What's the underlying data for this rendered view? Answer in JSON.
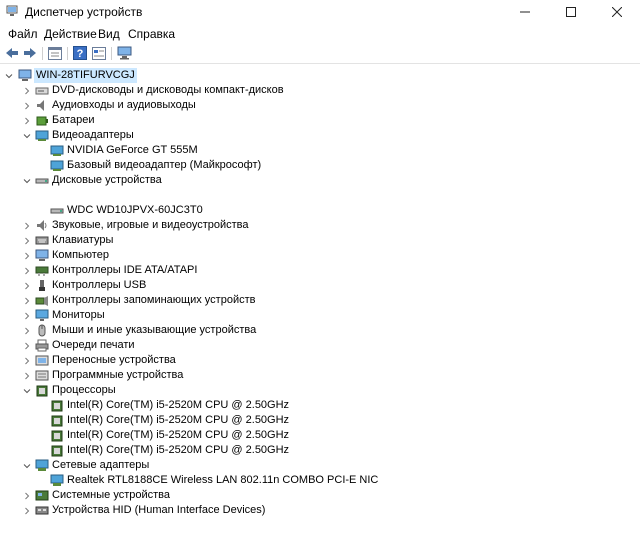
{
  "window": {
    "title": "Диспетчер устройств"
  },
  "menu": [
    "Файл",
    "Действие",
    "Вид",
    "Справка"
  ],
  "tree": {
    "root": "WIN-28TIFURVCGJ",
    "rows": [
      {
        "label": "DVD-дисководы и дисководы компакт-дисков",
        "icon": "dvd-drive-icon"
      },
      {
        "label": "Аудиовходы и аудиовыходы",
        "icon": "audio-icon"
      },
      {
        "label": "Батареи",
        "icon": "battery-icon"
      },
      {
        "label": "Видеоадаптеры",
        "icon": "display-adapter-icon"
      },
      {
        "label": "NVIDIA GeForce GT 555M",
        "icon": "display-adapter-icon"
      },
      {
        "label": "Базовый видеоадаптер (Майкрософт)",
        "icon": "display-adapter-icon"
      },
      {
        "label": "Дисковые устройства",
        "icon": "disk-drive-icon"
      },
      {
        "label": "WDC WD10JPVX-60JC3T0",
        "icon": "disk-drive-icon"
      },
      {
        "label": "Звуковые, игровые и видеоустройства",
        "icon": "sound-icon"
      },
      {
        "label": "Клавиатуры",
        "icon": "keyboard-icon"
      },
      {
        "label": "Компьютер",
        "icon": "computer-icon"
      },
      {
        "label": "Контроллеры IDE ATA/ATAPI",
        "icon": "ide-controller-icon"
      },
      {
        "label": "Контроллеры USB",
        "icon": "usb-icon"
      },
      {
        "label": "Контроллеры запоминающих устройств",
        "icon": "storage-controller-icon"
      },
      {
        "label": "Мониторы",
        "icon": "monitor-icon"
      },
      {
        "label": "Мыши и иные указывающие устройства",
        "icon": "mouse-icon"
      },
      {
        "label": "Очереди печати",
        "icon": "printer-icon"
      },
      {
        "label": "Переносные устройства",
        "icon": "portable-device-icon"
      },
      {
        "label": "Программные устройства",
        "icon": "software-device-icon"
      },
      {
        "label": "Процессоры",
        "icon": "processor-icon"
      },
      {
        "label": "Intel(R) Core(TM) i5-2520M CPU @ 2.50GHz",
        "icon": "processor-icon"
      },
      {
        "label": "Intel(R) Core(TM) i5-2520M CPU @ 2.50GHz",
        "icon": "processor-icon"
      },
      {
        "label": "Intel(R) Core(TM) i5-2520M CPU @ 2.50GHz",
        "icon": "processor-icon"
      },
      {
        "label": "Intel(R) Core(TM) i5-2520M CPU @ 2.50GHz",
        "icon": "processor-icon"
      },
      {
        "label": "Сетевые адаптеры",
        "icon": "network-adapter-icon"
      },
      {
        "label": "Realtek RTL8188CE Wireless LAN 802.11n COMBO PCI-E NIC",
        "icon": "network-adapter-icon"
      },
      {
        "label": "Системные устройства",
        "icon": "system-device-icon"
      },
      {
        "label": "Устройства HID (Human Interface Devices)",
        "icon": "hid-icon"
      }
    ]
  }
}
